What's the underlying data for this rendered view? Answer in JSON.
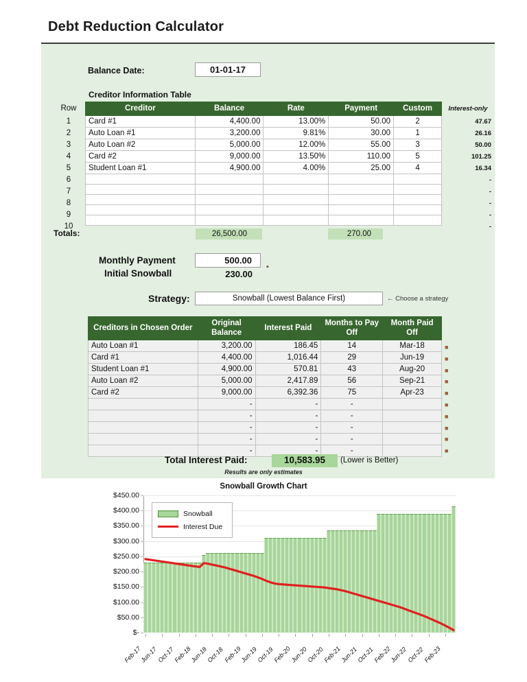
{
  "title": "Debt Reduction Calculator",
  "balance_date": {
    "label": "Balance Date:",
    "value": "01-01-17"
  },
  "creditor_table": {
    "caption": "Creditor Information Table",
    "row_header": "Row",
    "interest_only_header": "Interest-only",
    "headers": [
      "Creditor",
      "Balance",
      "Rate",
      "Payment",
      "Custom"
    ],
    "rows": [
      {
        "row": "1",
        "creditor": "Card #1",
        "balance": "4,400.00",
        "rate": "13.00%",
        "payment": "50.00",
        "custom": "2",
        "interest_only": "47.67"
      },
      {
        "row": "2",
        "creditor": "Auto Loan #1",
        "balance": "3,200.00",
        "rate": "9.81%",
        "payment": "30.00",
        "custom": "1",
        "interest_only": "26.16"
      },
      {
        "row": "3",
        "creditor": "Auto Loan #2",
        "balance": "5,000.00",
        "rate": "12.00%",
        "payment": "55.00",
        "custom": "3",
        "interest_only": "50.00"
      },
      {
        "row": "4",
        "creditor": "Card #2",
        "balance": "9,000.00",
        "rate": "13.50%",
        "payment": "110.00",
        "custom": "5",
        "interest_only": "101.25"
      },
      {
        "row": "5",
        "creditor": "Student Loan #1",
        "balance": "4,900.00",
        "rate": "4.00%",
        "payment": "25.00",
        "custom": "4",
        "interest_only": "16.34"
      },
      {
        "row": "6",
        "creditor": "",
        "balance": "",
        "rate": "",
        "payment": "",
        "custom": "",
        "interest_only": "-"
      },
      {
        "row": "7",
        "creditor": "",
        "balance": "",
        "rate": "",
        "payment": "",
        "custom": "",
        "interest_only": "-"
      },
      {
        "row": "8",
        "creditor": "",
        "balance": "",
        "rate": "",
        "payment": "",
        "custom": "",
        "interest_only": "-"
      },
      {
        "row": "9",
        "creditor": "",
        "balance": "",
        "rate": "",
        "payment": "",
        "custom": "",
        "interest_only": "-"
      },
      {
        "row": "10",
        "creditor": "",
        "balance": "",
        "rate": "",
        "payment": "",
        "custom": "",
        "interest_only": "-"
      }
    ],
    "totals_label": "Totals:",
    "totals_balance": "26,500.00",
    "totals_payment": "270.00"
  },
  "payment": {
    "monthly_label": "Monthly Payment",
    "monthly_value": "500.00",
    "snowball_label": "Initial Snowball",
    "snowball_value": "230.00"
  },
  "strategy": {
    "label": "Strategy:",
    "value": "Snowball (Lowest Balance First)",
    "note": "← Choose a strategy"
  },
  "results_table": {
    "headers": [
      "Creditors in Chosen Order",
      "Original Balance",
      "Interest Paid",
      "Months to Pay Off",
      "Month Paid Off"
    ],
    "rows": [
      {
        "creditor": "Auto Loan #1",
        "balance": "3,200.00",
        "interest": "186.45",
        "months": "14",
        "paid_off": "Mar-18"
      },
      {
        "creditor": "Card #1",
        "balance": "4,400.00",
        "interest": "1,016.44",
        "months": "29",
        "paid_off": "Jun-19"
      },
      {
        "creditor": "Student Loan #1",
        "balance": "4,900.00",
        "interest": "570.81",
        "months": "43",
        "paid_off": "Aug-20"
      },
      {
        "creditor": "Auto Loan #2",
        "balance": "5,000.00",
        "interest": "2,417.89",
        "months": "56",
        "paid_off": "Sep-21"
      },
      {
        "creditor": "Card #2",
        "balance": "9,000.00",
        "interest": "6,392.36",
        "months": "75",
        "paid_off": "Apr-23"
      },
      {
        "creditor": "",
        "balance": "-",
        "interest": "-",
        "months": "-",
        "paid_off": ""
      },
      {
        "creditor": "",
        "balance": "-",
        "interest": "-",
        "months": "-",
        "paid_off": ""
      },
      {
        "creditor": "",
        "balance": "-",
        "interest": "-",
        "months": "-",
        "paid_off": ""
      },
      {
        "creditor": "",
        "balance": "-",
        "interest": "-",
        "months": "-",
        "paid_off": ""
      },
      {
        "creditor": "",
        "balance": "-",
        "interest": "-",
        "months": "-",
        "paid_off": ""
      }
    ]
  },
  "total_interest": {
    "label": "Total Interest Paid:",
    "value": "10,583.95",
    "note": "(Lower is Better)"
  },
  "estimates_note": "Results are only estimates",
  "colors": {
    "panel": "#e3efe1",
    "header_green": "#38662f",
    "highlight_green": "#c3e0b8",
    "bar_green": "#a8d59a",
    "interest_red": "#e02020"
  },
  "chart_data": {
    "type": "bar",
    "title": "Snowball Growth Chart",
    "xlabel": "",
    "ylabel": "",
    "ylim": [
      0,
      450
    ],
    "grid": true,
    "legend_position": "top-left",
    "ytick_labels": [
      "$-",
      "$50.00",
      "$100.00",
      "$150.00",
      "$200.00",
      "$250.00",
      "$300.00",
      "$350.00",
      "$400.00",
      "$450.00"
    ],
    "ytick_values": [
      0,
      50,
      100,
      150,
      200,
      250,
      300,
      350,
      400,
      450
    ],
    "xtick_labels": [
      "Feb-17",
      "Jun-17",
      "Oct-17",
      "Feb-18",
      "Jun-18",
      "Oct-18",
      "Feb-19",
      "Jun-19",
      "Oct-19",
      "Feb-20",
      "Jun-20",
      "Oct-20",
      "Feb-21",
      "Jun-21",
      "Oct-21",
      "Feb-22",
      "Jun-22",
      "Oct-22",
      "Feb-23"
    ],
    "xtick_indices": [
      0,
      4,
      8,
      12,
      16,
      20,
      24,
      28,
      32,
      36,
      40,
      44,
      48,
      52,
      56,
      60,
      64,
      68,
      72
    ],
    "series": [
      {
        "name": "Snowball",
        "type": "bar",
        "color": "#a8d59a",
        "values": [
          230,
          230,
          230,
          230,
          230,
          230,
          230,
          230,
          230,
          230,
          230,
          230,
          230,
          230,
          255,
          260,
          260,
          260,
          260,
          260,
          260,
          260,
          260,
          260,
          260,
          260,
          260,
          260,
          260,
          310,
          310,
          310,
          310,
          310,
          310,
          310,
          310,
          310,
          310,
          310,
          310,
          310,
          310,
          310,
          335,
          335,
          335,
          335,
          335,
          335,
          335,
          335,
          335,
          335,
          335,
          335,
          390,
          390,
          390,
          390,
          390,
          390,
          390,
          390,
          390,
          390,
          390,
          390,
          390,
          390,
          390,
          390,
          390,
          390,
          415
        ]
      },
      {
        "name": "Interest Due",
        "type": "line",
        "color": "#e02020",
        "values": [
          241,
          239,
          237,
          235,
          233,
          231,
          229,
          227,
          225,
          223,
          221,
          219,
          217,
          215,
          228,
          226,
          223,
          220,
          217,
          214,
          210,
          206,
          202,
          198,
          194,
          190,
          186,
          181,
          176,
          170,
          165,
          161,
          159,
          158,
          157,
          156,
          155,
          154,
          153,
          152,
          151,
          150,
          149,
          148,
          146,
          144,
          142,
          139,
          136,
          132,
          128,
          124,
          120,
          116,
          112,
          108,
          104,
          100,
          96,
          92,
          88,
          84,
          79,
          74,
          69,
          64,
          59,
          54,
          48,
          42,
          36,
          30,
          23,
          16,
          8
        ]
      }
    ]
  }
}
